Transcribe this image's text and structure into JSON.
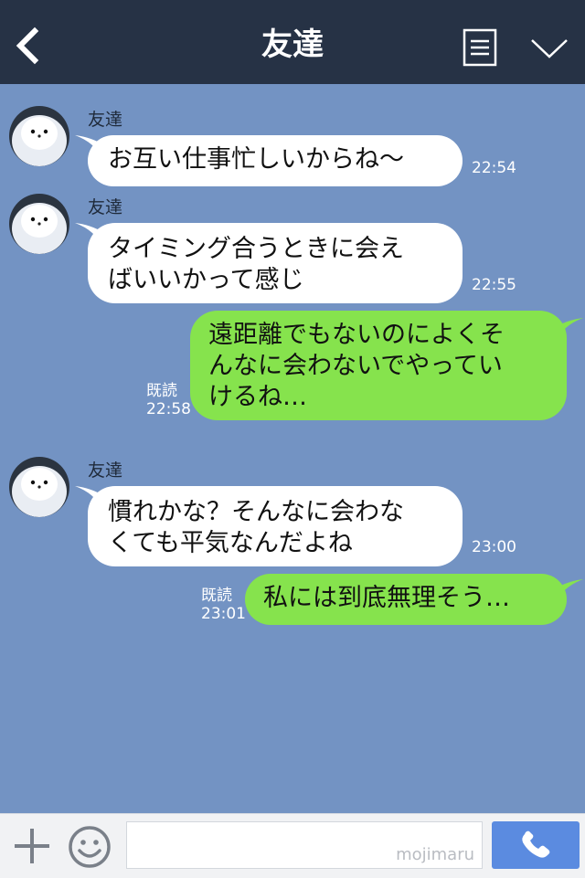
{
  "header": {
    "title": "友達"
  },
  "messages": [
    {
      "sender": "友達",
      "text": "お互い仕事忙しいからね〜",
      "time": "22:54"
    },
    {
      "sender": "友達",
      "text": "タイミング合うときに会え\nばいいかって感じ",
      "time": "22:55"
    },
    {
      "text": "遠距離でもないのによくそ\nんなに会わないでやってい\nけるね…",
      "read": "既読",
      "time": "22:58"
    },
    {
      "sender": "友達",
      "text": "慣れかな？そんなに会わな\nくても平気なんだよね",
      "time": "23:00"
    },
    {
      "text": "私には到底無理そう…",
      "read": "既読",
      "time": "23:01"
    }
  ],
  "footer": {
    "watermark": "mojimaru"
  },
  "colors": {
    "background": "#7393c3",
    "header": "#263245",
    "incoming_bubble": "#ffffff",
    "outgoing_bubble": "#86e34d",
    "call_button": "#5b8be0"
  },
  "icons": {
    "back": "chevron-left-icon",
    "menu": "list-icon",
    "collapse": "chevron-down-icon",
    "add": "plus-icon",
    "emoji": "smile-icon",
    "call": "phone-icon"
  }
}
